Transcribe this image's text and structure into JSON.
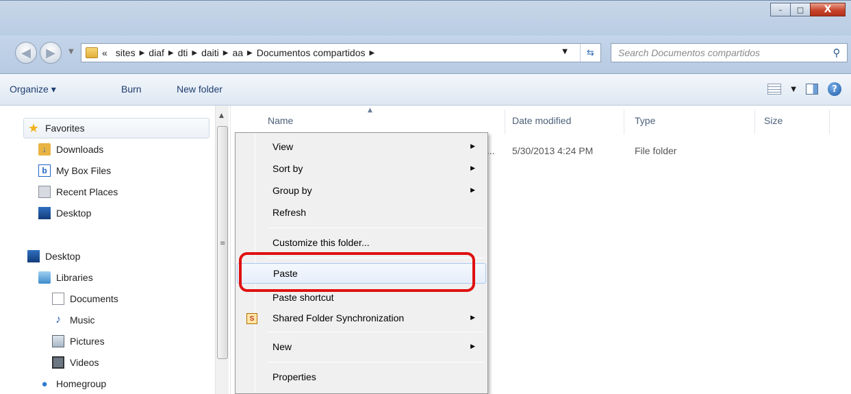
{
  "address": {
    "prefix": "«",
    "crumbs": [
      "sites",
      "diaf",
      "dti",
      "daiti",
      "aa",
      "Documentos compartidos"
    ]
  },
  "search": {
    "placeholder": "Search Documentos compartidos"
  },
  "window": {
    "minimize": "–",
    "maximize": "□",
    "close": "X"
  },
  "toolbar": {
    "organize": "Organize ▾",
    "burn": "Burn",
    "new_folder": "New folder"
  },
  "sidebar": {
    "favorites_label": "Favorites",
    "favorites": [
      "Downloads",
      "My Box Files",
      "Recent Places",
      "Desktop"
    ],
    "desktop_label": "Desktop",
    "libraries_label": "Libraries",
    "libraries": [
      "Documents",
      "Music",
      "Pictures",
      "Videos"
    ],
    "homegroup_label": "Homegroup"
  },
  "columns": {
    "name": "Name",
    "date": "Date modified",
    "type": "Type",
    "size": "Size"
  },
  "row": {
    "ellipsis": "...",
    "date": "5/30/2013 4:24 PM",
    "type": "File folder"
  },
  "menu": {
    "view": "View",
    "sort_by": "Sort by",
    "group_by": "Group by",
    "refresh": "Refresh",
    "customize": "Customize this folder...",
    "paste": "Paste",
    "paste_shortcut": "Paste shortcut",
    "shared_sync": "Shared Folder Synchronization",
    "new": "New",
    "properties": "Properties"
  },
  "colors": {
    "highlight": "#e01010",
    "accent": "#1e3c6e"
  }
}
